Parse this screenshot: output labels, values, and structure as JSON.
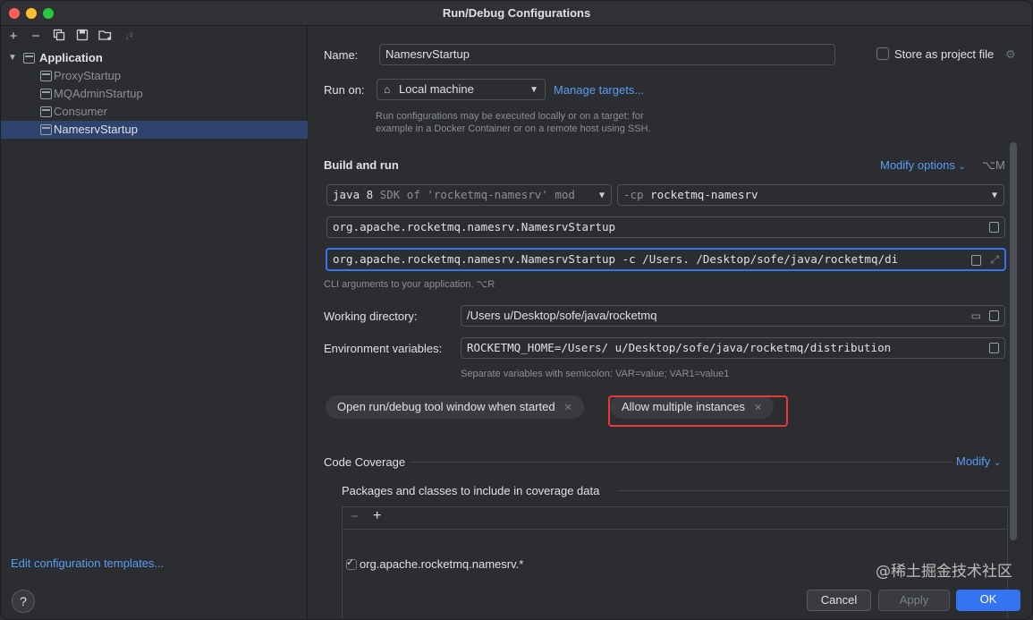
{
  "window": {
    "title": "Run/Debug Configurations",
    "traffic_colors": [
      "#ff5f57",
      "#febc2e",
      "#28c840"
    ]
  },
  "toolbar": {
    "icons": [
      "add-icon",
      "remove-icon",
      "copy-icon",
      "save-icon",
      "new-folder-icon",
      "sort-icon"
    ]
  },
  "tree": {
    "root_label": "Application",
    "items": [
      {
        "label": "ProxyStartup",
        "selected": false
      },
      {
        "label": "MQAdminStartup",
        "selected": false
      },
      {
        "label": "Consumer",
        "selected": false
      },
      {
        "label": "NamesrvStartup",
        "selected": true
      }
    ],
    "edit_templates_label": "Edit configuration templates...",
    "help_label": "?"
  },
  "form": {
    "name_label": "Name:",
    "name_value": "NamesrvStartup",
    "store_project_label": "Store as project file",
    "run_on_label": "Run on:",
    "run_on_value": "Local machine",
    "manage_targets_label": "Manage targets...",
    "run_on_hint_line1": "Run configurations may be executed locally or on a target: for",
    "run_on_hint_line2": "example in a Docker Container or on a remote host using SSH.",
    "build_run_label": "Build and run",
    "modify_options_label": "Modify options",
    "modify_options_shortcut": "⌥M",
    "jdk_value": "java 8",
    "jdk_detail": "SDK of 'rocketmq-namesrv' mod",
    "classpath_prefix": "-cp",
    "classpath_value": "rocketmq-namesrv",
    "main_class_value": "org.apache.rocketmq.namesrv.NamesrvStartup",
    "program_args_value": "org.apache.rocketmq.namesrv.NamesrvStartup -c /Users.        /Desktop/sofe/java/rocketmq/di",
    "cli_hint": "CLI arguments to your application. ⌥R",
    "working_dir_label": "Working directory:",
    "working_dir_value": "/Users        u/Desktop/sofe/java/rocketmq",
    "env_vars_label": "Environment variables:",
    "env_vars_value": "ROCKETMQ_HOME=/Users/       u/Desktop/sofe/java/rocketmq/distribution",
    "env_hint": "Separate variables with semicolon: VAR=value; VAR1=value1",
    "chips": [
      {
        "label": "Open run/debug tool window when started",
        "highlighted": false
      },
      {
        "label": "Allow multiple instances",
        "highlighted": true
      }
    ],
    "code_coverage_label": "Code Coverage",
    "modify_label": "Modify",
    "coverage_include_label": "Packages and classes to include in coverage data",
    "coverage_entry": "org.apache.rocketmq.namesrv.*",
    "coverage_entry_checked": true
  },
  "buttons": {
    "cancel_label": "Cancel",
    "apply_label": "Apply",
    "ok_label": "OK"
  },
  "watermark": "@稀土掘金技术社区",
  "colors": {
    "accent": "#589df6",
    "selection": "#2e436e",
    "highlight": "#e53935",
    "ok_button": "#3574f0"
  }
}
